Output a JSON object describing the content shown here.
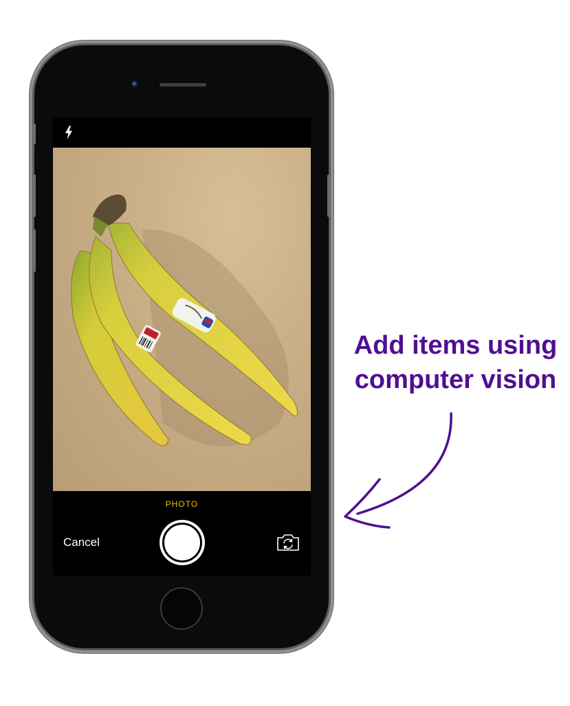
{
  "camera": {
    "mode_label": "PHOTO",
    "cancel_label": "Cancel"
  },
  "callout": {
    "line1": "Add items using",
    "line2": "computer vision"
  },
  "colors": {
    "accent_mode": "#f4c400",
    "callout": "#4f0f92"
  },
  "icons": [
    "flash-icon",
    "shutter-button",
    "flip-camera-icon",
    "home-button"
  ]
}
